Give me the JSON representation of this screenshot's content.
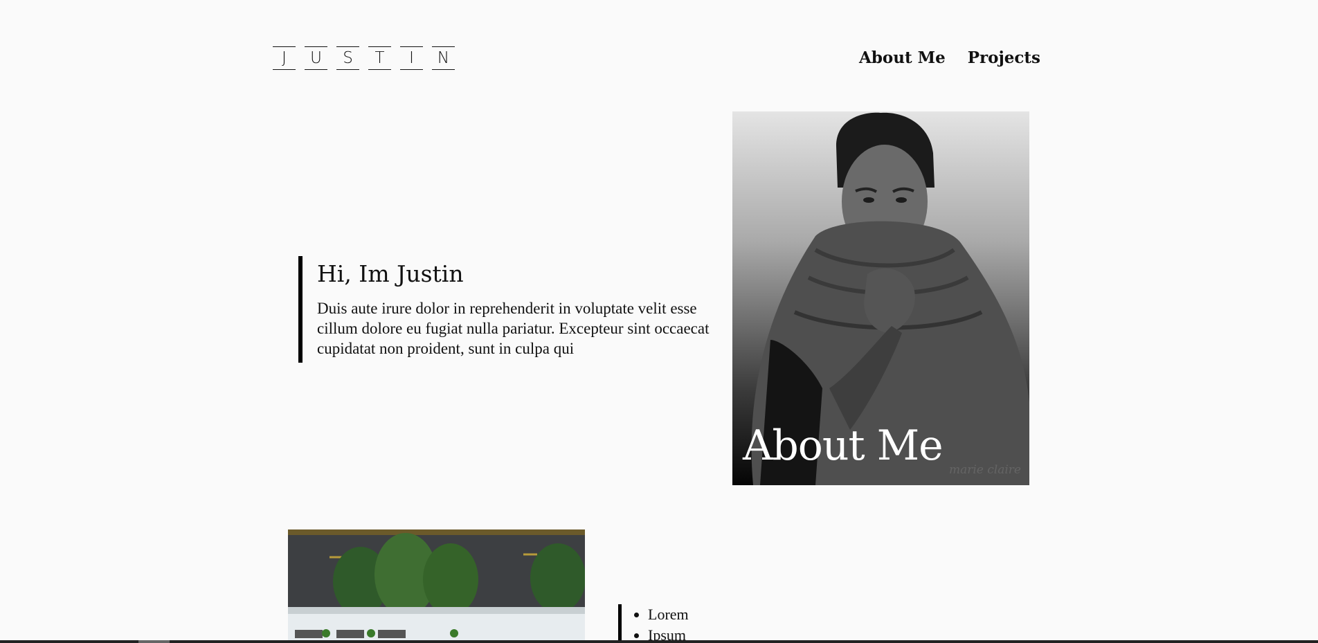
{
  "logo": {
    "letters": [
      "J",
      "U",
      "S",
      "T",
      "I",
      "N"
    ]
  },
  "nav": {
    "items": [
      {
        "label": "About Me"
      },
      {
        "label": "Projects"
      }
    ]
  },
  "intro": {
    "heading": "Hi, Im Justin",
    "body": "Duis aute irure dolor in reprehenderit in voluptate velit esse cillum dolore eu fugiat nulla pariatur. Excepteur sint occaecat cupidatat non proident, sunt in culpa qui"
  },
  "portrait": {
    "caption": "About Me",
    "watermark": "marie claire"
  },
  "list": {
    "items": [
      "Lorem",
      "Ipsum"
    ]
  }
}
